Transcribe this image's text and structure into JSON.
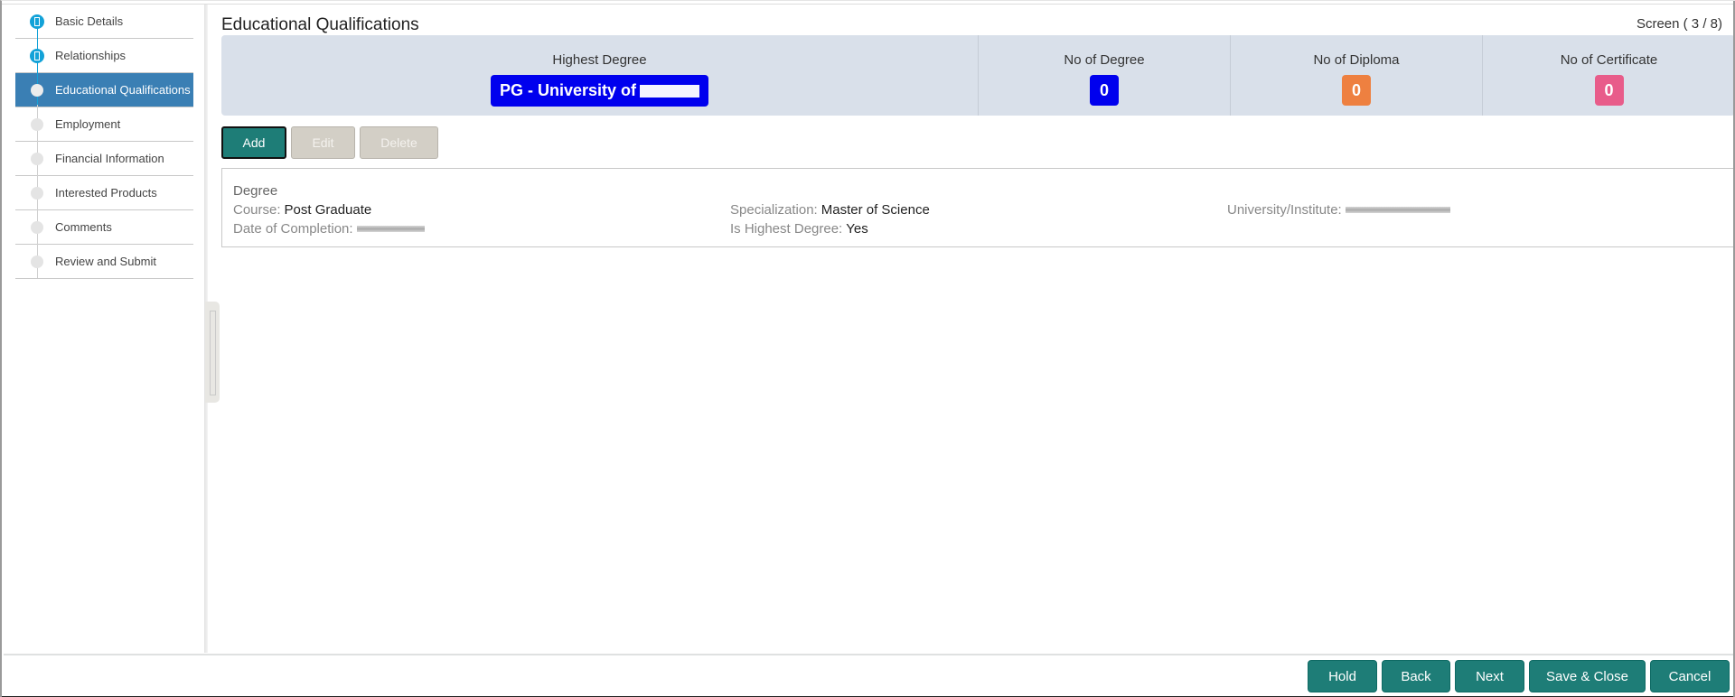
{
  "sidebar": {
    "steps": [
      {
        "label": "Basic Details",
        "state": "done"
      },
      {
        "label": "Relationships",
        "state": "done"
      },
      {
        "label": "Educational Qualifications",
        "state": "active"
      },
      {
        "label": "Employment",
        "state": "pending"
      },
      {
        "label": "Financial Information",
        "state": "pending"
      },
      {
        "label": "Interested Products",
        "state": "pending"
      },
      {
        "label": "Comments",
        "state": "pending"
      },
      {
        "label": "Review and Submit",
        "state": "pending"
      }
    ]
  },
  "header": {
    "title": "Educational Qualifications",
    "screen_indicator": "Screen ( 3 / 8)"
  },
  "summary": {
    "highest_degree_label": "Highest Degree",
    "highest_degree_value": "PG - University of",
    "degree_count_label": "No of Degree",
    "degree_count": "0",
    "diploma_count_label": "No of Diploma",
    "diploma_count": "0",
    "certificate_count_label": "No of Certificate",
    "certificate_count": "0",
    "colors": {
      "highest_degree": "#0000ee",
      "degree": "#0000ee",
      "diploma": "#ee8040",
      "certificate": "#e85c8a"
    }
  },
  "actions": {
    "add": "Add",
    "edit": "Edit",
    "delete": "Delete"
  },
  "record": {
    "title": "Degree",
    "course_label": "Course:",
    "course_value": "Post Graduate",
    "specialization_label": "Specialization:",
    "specialization_value": "Master of Science",
    "university_label": "University/Institute:",
    "completion_label": "Date of Completion:",
    "highest_label": "Is Highest Degree:",
    "highest_value": "Yes"
  },
  "footer": {
    "hold": "Hold",
    "back": "Back",
    "next": "Next",
    "save_close": "Save & Close",
    "cancel": "Cancel"
  }
}
